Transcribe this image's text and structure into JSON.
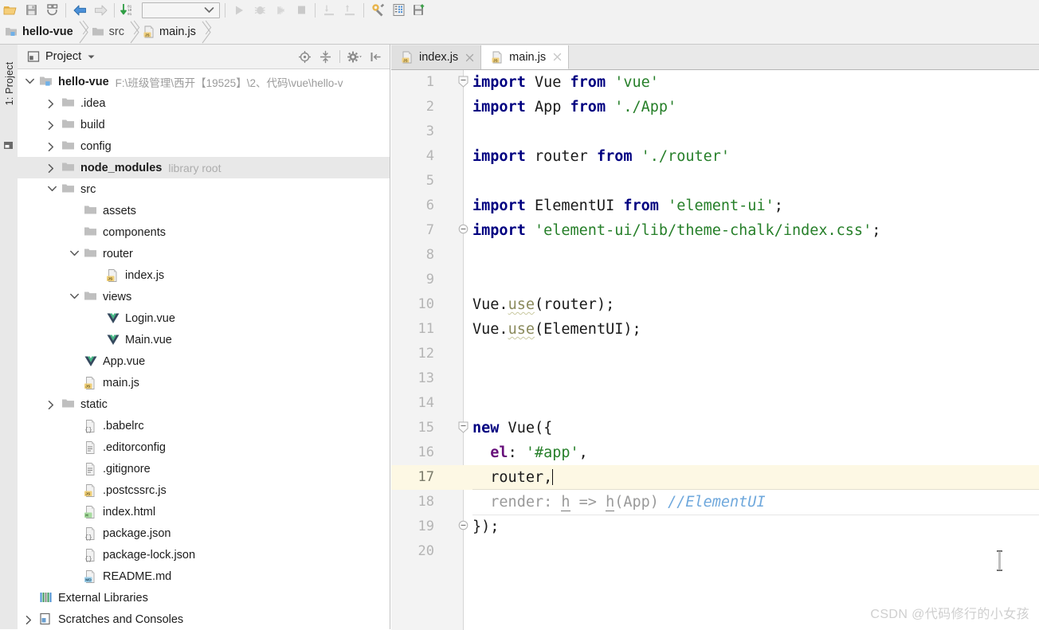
{
  "toolbar": {
    "buttons": [
      {
        "name": "open-folder-icon",
        "title": "Open"
      },
      {
        "name": "save-all-icon",
        "title": "Save All"
      },
      {
        "name": "sync-refresh-icon",
        "title": "Synchronize"
      },
      {
        "name": "back-arrow-icon",
        "title": "Back"
      },
      {
        "name": "forward-arrow-icon",
        "title": "Forward"
      },
      {
        "name": "update-project-icon",
        "title": "Update Project"
      },
      {
        "name": "run-icon",
        "title": "Run"
      },
      {
        "name": "debug-icon",
        "title": "Debug"
      },
      {
        "name": "coverage-icon",
        "title": "Run with Coverage"
      },
      {
        "name": "stop-icon",
        "title": "Stop"
      },
      {
        "name": "step-in-icon",
        "title": "Step In"
      },
      {
        "name": "step-out-icon",
        "title": "Step Out"
      },
      {
        "name": "settings-wrench-icon",
        "title": "Settings"
      },
      {
        "name": "project-structure-icon",
        "title": "Project Structure"
      },
      {
        "name": "commit-icon",
        "title": "Commit"
      }
    ],
    "run_config": {
      "value": "",
      "placeholder": ""
    }
  },
  "breadcrumb": {
    "items": [
      {
        "label": "hello-vue",
        "icon": "module-icon",
        "bold": true
      },
      {
        "label": "src",
        "icon": "folder-icon",
        "bold": false
      },
      {
        "label": "main.js",
        "icon": "js-file-icon",
        "bold": false
      }
    ]
  },
  "tool_window": {
    "vertical_label": "1: Project"
  },
  "project_panel": {
    "title": "Project",
    "actions": [
      {
        "name": "scroll-from-source-icon"
      },
      {
        "name": "collapse-all-icon"
      },
      {
        "name": "settings-gear-icon"
      },
      {
        "name": "hide-panel-icon"
      }
    ],
    "tree": [
      {
        "indent": 0,
        "arrow": "down",
        "icon": "module-icon",
        "label": "hello-vue",
        "bold": true,
        "path": "F:\\班级管理\\西开【19525】\\2、代码\\vue\\hello-v",
        "selected": false
      },
      {
        "indent": 1,
        "arrow": "right",
        "icon": "folder-icon",
        "label": ".idea",
        "bold": false,
        "selected": false
      },
      {
        "indent": 1,
        "arrow": "right",
        "icon": "folder-icon",
        "label": "build",
        "bold": false,
        "selected": false
      },
      {
        "indent": 1,
        "arrow": "right",
        "icon": "folder-icon",
        "label": "config",
        "bold": false,
        "selected": false
      },
      {
        "indent": 1,
        "arrow": "right",
        "icon": "folder-icon",
        "label": "node_modules",
        "bold": true,
        "note": "library root",
        "selected": true
      },
      {
        "indent": 1,
        "arrow": "down",
        "icon": "folder-icon",
        "label": "src",
        "bold": false,
        "selected": false
      },
      {
        "indent": 2,
        "arrow": "none",
        "icon": "folder-icon",
        "label": "assets",
        "bold": false,
        "selected": false
      },
      {
        "indent": 2,
        "arrow": "none",
        "icon": "folder-icon",
        "label": "components",
        "bold": false,
        "selected": false
      },
      {
        "indent": 2,
        "arrow": "down",
        "icon": "folder-icon",
        "label": "router",
        "bold": false,
        "selected": false
      },
      {
        "indent": 3,
        "arrow": "none",
        "icon": "js-file-icon",
        "label": "index.js",
        "bold": false,
        "selected": false
      },
      {
        "indent": 2,
        "arrow": "down",
        "icon": "folder-icon",
        "label": "views",
        "bold": false,
        "selected": false
      },
      {
        "indent": 3,
        "arrow": "none",
        "icon": "vue-file-icon",
        "label": "Login.vue",
        "bold": false,
        "selected": false
      },
      {
        "indent": 3,
        "arrow": "none",
        "icon": "vue-file-icon",
        "label": "Main.vue",
        "bold": false,
        "selected": false
      },
      {
        "indent": 2,
        "arrow": "none",
        "icon": "vue-file-icon",
        "label": "App.vue",
        "bold": false,
        "selected": false
      },
      {
        "indent": 2,
        "arrow": "none",
        "icon": "js-file-icon",
        "label": "main.js",
        "bold": false,
        "selected": false
      },
      {
        "indent": 1,
        "arrow": "right",
        "icon": "folder-icon",
        "label": "static",
        "bold": false,
        "selected": false
      },
      {
        "indent": 2,
        "arrow": "none",
        "icon": "json-file-icon",
        "label": ".babelrc",
        "bold": false,
        "selected": false
      },
      {
        "indent": 2,
        "arrow": "none",
        "icon": "text-file-icon",
        "label": ".editorconfig",
        "bold": false,
        "selected": false
      },
      {
        "indent": 2,
        "arrow": "none",
        "icon": "text-file-icon",
        "label": ".gitignore",
        "bold": false,
        "selected": false
      },
      {
        "indent": 2,
        "arrow": "none",
        "icon": "js-file-icon",
        "label": ".postcssrc.js",
        "bold": false,
        "selected": false
      },
      {
        "indent": 2,
        "arrow": "none",
        "icon": "html-file-icon",
        "label": "index.html",
        "bold": false,
        "selected": false
      },
      {
        "indent": 2,
        "arrow": "none",
        "icon": "json-file-icon",
        "label": "package.json",
        "bold": false,
        "selected": false
      },
      {
        "indent": 2,
        "arrow": "none",
        "icon": "json-file-icon",
        "label": "package-lock.json",
        "bold": false,
        "selected": false
      },
      {
        "indent": 2,
        "arrow": "none",
        "icon": "markdown-file-icon",
        "label": "README.md",
        "bold": false,
        "selected": false
      },
      {
        "indent": 0,
        "arrow": "none",
        "icon": "external-libraries-icon",
        "label": "External Libraries",
        "bold": false,
        "selected": false
      },
      {
        "indent": 0,
        "arrow": "right",
        "icon": "scratches-icon",
        "label": "Scratches and Consoles",
        "bold": false,
        "selected": false
      }
    ]
  },
  "editor": {
    "tabs": [
      {
        "label": "index.js",
        "icon": "js-file-icon",
        "active": false,
        "close": "×"
      },
      {
        "label": "main.js",
        "icon": "js-file-icon",
        "active": true,
        "close": "×"
      }
    ],
    "current_line": 17,
    "fold_lines": [
      1,
      7,
      15,
      19
    ],
    "lines": [
      {
        "n": "1",
        "text": "import Vue from 'vue'"
      },
      {
        "n": "2",
        "text": "import App from './App'"
      },
      {
        "n": "3",
        "text": ""
      },
      {
        "n": "4",
        "text": "import router from './router'"
      },
      {
        "n": "5",
        "text": ""
      },
      {
        "n": "6",
        "text": "import ElementUI from 'element-ui';"
      },
      {
        "n": "7",
        "text": "import 'element-ui/lib/theme-chalk/index.css';"
      },
      {
        "n": "8",
        "text": ""
      },
      {
        "n": "9",
        "text": ""
      },
      {
        "n": "10",
        "text": "Vue.use(router);"
      },
      {
        "n": "11",
        "text": "Vue.use(ElementUI);"
      },
      {
        "n": "12",
        "text": ""
      },
      {
        "n": "13",
        "text": ""
      },
      {
        "n": "14",
        "text": ""
      },
      {
        "n": "15",
        "text": "new Vue({"
      },
      {
        "n": "16",
        "text": "  el: '#app',"
      },
      {
        "n": "17",
        "text": "  router,"
      },
      {
        "n": "18",
        "text": "  render: h => h(App) //ElementUI"
      },
      {
        "n": "19",
        "text": "});"
      },
      {
        "n": "20",
        "text": ""
      }
    ]
  },
  "watermark": {
    "text": "CSDN @代码修行的小女孩"
  },
  "colors": {
    "keyword": "#000080",
    "string": "#267f29",
    "comment": "#6fa8dc",
    "property": "#660e7a",
    "function": "#8a8a5c",
    "current_line_bg": "#fdf8e4",
    "selection_bg": "#e8e8e8",
    "panel_bg": "#f2f2f2"
  }
}
